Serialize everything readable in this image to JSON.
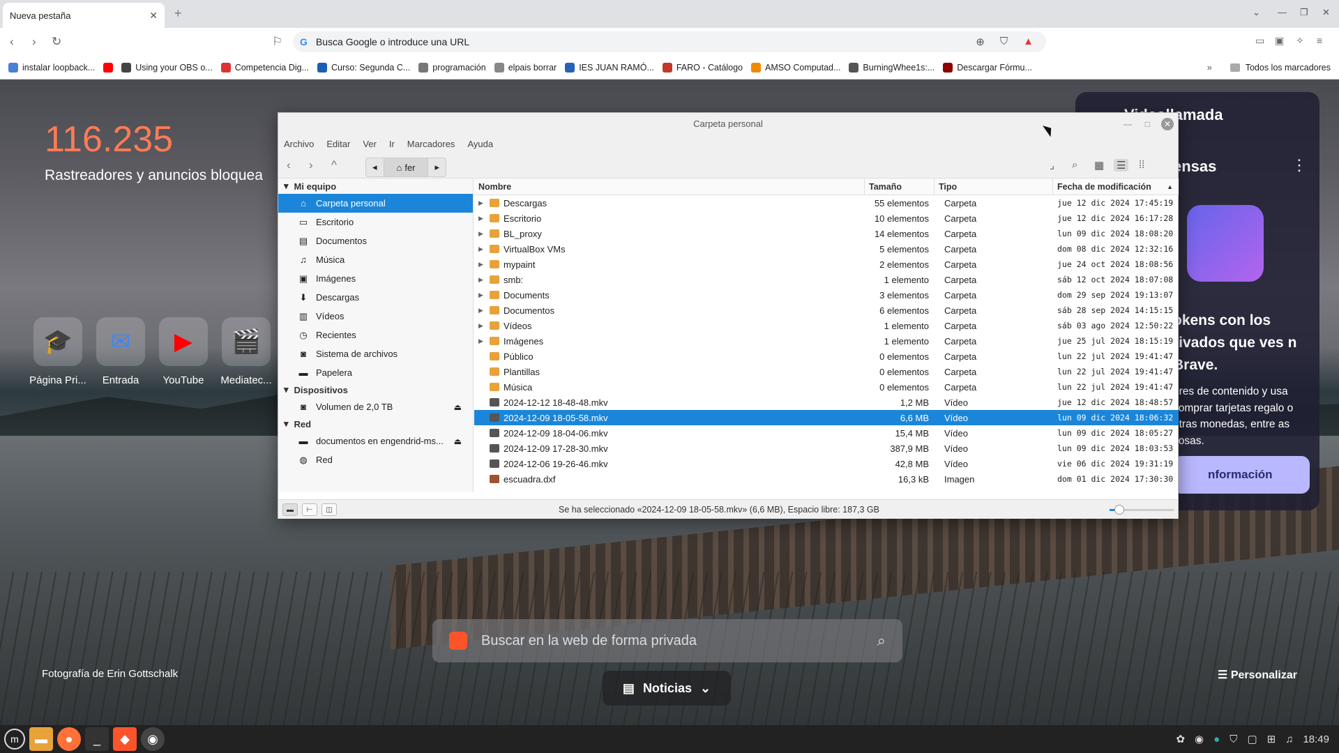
{
  "browser": {
    "tab_title": "Nueva pestaña",
    "url_placeholder": "Busca Google o introduce una URL",
    "bookmarks": [
      {
        "label": "instalar loopback...",
        "color": "#4a7fd6"
      },
      {
        "label": "",
        "color": "#ff0000"
      },
      {
        "label": "Using your OBS o...",
        "color": "#444444"
      },
      {
        "label": "Competencia Dig...",
        "color": "#d33"
      },
      {
        "label": "Curso: Segunda C...",
        "color": "#1a5fb4"
      },
      {
        "label": "programación",
        "color": "#777777"
      },
      {
        "label": "elpais borrar",
        "color": "#888888"
      },
      {
        "label": "IES JUAN RAMÓ...",
        "color": "#2563b8"
      },
      {
        "label": "FARO - Catálogo",
        "color": "#c0392b"
      },
      {
        "label": "AMSO Computad...",
        "color": "#f08a00"
      },
      {
        "label": "BurningWhee1s:...",
        "color": "#555555"
      },
      {
        "label": "Descargar Fórmu...",
        "color": "#8b0000"
      }
    ],
    "all_bookmarks": "Todos los marcadores"
  },
  "newtab": {
    "counter": "116.235",
    "counter_label": "Rastreadores y anuncios bloquea",
    "tiles": [
      {
        "label": "Página Pri...",
        "icon": "graduation-cap",
        "color": "#3a7bd5"
      },
      {
        "label": "Entrada",
        "icon": "mail",
        "color": "#4285f4"
      },
      {
        "label": "YouTube",
        "icon": "youtube",
        "color": "#ff0000"
      },
      {
        "label": "Mediatec...",
        "icon": "clapperboard",
        "color": "#2b7de9"
      }
    ],
    "photo_credit": "Fotografía de Erin Gottschalk",
    "search_placeholder": "Buscar en la web de forma privada",
    "news_label": "Noticias",
    "customize": "Personalizar"
  },
  "promo": {
    "title_top": "Videollamada",
    "title": "ensas",
    "heading": "okens con los rivados que ves n Brave.",
    "body": "ores de contenido y usa comprar tarjetas regalo o otras monedas, entre as cosas.",
    "button": "nformación"
  },
  "filemanager": {
    "title": "Carpeta personal",
    "menu": [
      "Archivo",
      "Editar",
      "Ver",
      "Ir",
      "Marcadores",
      "Ayuda"
    ],
    "path_label": "fer",
    "sidebar": {
      "section1": "Mi equipo",
      "items1": [
        {
          "label": "Carpeta personal",
          "icon": "⌂",
          "selected": true
        },
        {
          "label": "Escritorio",
          "icon": "▭"
        },
        {
          "label": "Documentos",
          "icon": "▤"
        },
        {
          "label": "Música",
          "icon": "♫"
        },
        {
          "label": "Imágenes",
          "icon": "▣"
        },
        {
          "label": "Descargas",
          "icon": "⬇"
        },
        {
          "label": "Vídeos",
          "icon": "▥"
        },
        {
          "label": "Recientes",
          "icon": "◷"
        },
        {
          "label": "Sistema de archivos",
          "icon": "◙"
        },
        {
          "label": "Papelera",
          "icon": "▬"
        }
      ],
      "section2": "Dispositivos",
      "items2": [
        {
          "label": "Volumen de 2,0 TB",
          "icon": "◙",
          "eject": true
        }
      ],
      "section3": "Red",
      "items3": [
        {
          "label": "documentos en engendrid-ms...",
          "icon": "▬",
          "eject": true
        },
        {
          "label": "Red",
          "icon": "◍"
        }
      ]
    },
    "columns": {
      "name": "Nombre",
      "size": "Tamaño",
      "type": "Tipo",
      "date": "Fecha de modificación"
    },
    "rows": [
      {
        "name": "Descargas",
        "size": "55 elementos",
        "type": "Carpeta",
        "date": "jue 12 dic 2024 17:45:19",
        "expandable": true,
        "kind": "folder"
      },
      {
        "name": "Escritorio",
        "size": "10 elementos",
        "type": "Carpeta",
        "date": "jue 12 dic 2024 16:17:28",
        "expandable": true,
        "kind": "folder"
      },
      {
        "name": "BL_proxy",
        "size": "14 elementos",
        "type": "Carpeta",
        "date": "lun 09 dic 2024 18:08:20",
        "expandable": true,
        "kind": "folder"
      },
      {
        "name": "VirtualBox VMs",
        "size": "5 elementos",
        "type": "Carpeta",
        "date": "dom 08 dic 2024 12:32:16",
        "expandable": true,
        "kind": "folder"
      },
      {
        "name": "mypaint",
        "size": "2 elementos",
        "type": "Carpeta",
        "date": "jue 24 oct 2024 18:08:56",
        "expandable": true,
        "kind": "folder"
      },
      {
        "name": "smb:",
        "size": "1 elemento",
        "type": "Carpeta",
        "date": "sáb 12 oct 2024 18:07:08",
        "expandable": true,
        "kind": "folder"
      },
      {
        "name": "Documents",
        "size": "3 elementos",
        "type": "Carpeta",
        "date": "dom 29 sep 2024 19:13:07",
        "expandable": true,
        "kind": "folder"
      },
      {
        "name": "Documentos",
        "size": "6 elementos",
        "type": "Carpeta",
        "date": "sáb 28 sep 2024 14:15:15",
        "expandable": true,
        "kind": "folder"
      },
      {
        "name": "Vídeos",
        "size": "1 elemento",
        "type": "Carpeta",
        "date": "sáb 03 ago 2024 12:50:22",
        "expandable": true,
        "kind": "folder"
      },
      {
        "name": "Imágenes",
        "size": "1 elemento",
        "type": "Carpeta",
        "date": "jue 25 jul 2024 18:15:19",
        "expandable": true,
        "kind": "folder"
      },
      {
        "name": "Público",
        "size": "0 elementos",
        "type": "Carpeta",
        "date": "lun 22 jul 2024 19:41:47",
        "expandable": false,
        "kind": "folder"
      },
      {
        "name": "Plantillas",
        "size": "0 elementos",
        "type": "Carpeta",
        "date": "lun 22 jul 2024 19:41:47",
        "expandable": false,
        "kind": "folder"
      },
      {
        "name": "Música",
        "size": "0 elementos",
        "type": "Carpeta",
        "date": "lun 22 jul 2024 19:41:47",
        "expandable": false,
        "kind": "folder"
      },
      {
        "name": "2024-12-12 18-48-48.mkv",
        "size": "1,2 MB",
        "type": "Vídeo",
        "date": "jue 12 dic 2024 18:48:57",
        "expandable": false,
        "kind": "video"
      },
      {
        "name": "2024-12-09 18-05-58.mkv",
        "size": "6,6 MB",
        "type": "Vídeo",
        "date": "lun 09 dic 2024 18:06:32",
        "expandable": false,
        "kind": "video",
        "selected": true
      },
      {
        "name": "2024-12-09 18-04-06.mkv",
        "size": "15,4 MB",
        "type": "Vídeo",
        "date": "lun 09 dic 2024 18:05:27",
        "expandable": false,
        "kind": "video"
      },
      {
        "name": "2024-12-09 17-28-30.mkv",
        "size": "387,9 MB",
        "type": "Vídeo",
        "date": "lun 09 dic 2024 18:03:53",
        "expandable": false,
        "kind": "video"
      },
      {
        "name": "2024-12-06 19-26-46.mkv",
        "size": "42,8 MB",
        "type": "Vídeo",
        "date": "vie 06 dic 2024 19:31:19",
        "expandable": false,
        "kind": "video"
      },
      {
        "name": "escuadra.dxf",
        "size": "16,3 kB",
        "type": "Imagen",
        "date": "dom 01 dic 2024 17:30:30",
        "expandable": false,
        "kind": "image"
      }
    ],
    "status": "Se ha seleccionado «2024-12-09 18-05-58.mkv» (6,6 MB), Espacio libre: 187,3 GB",
    "zoom_level": 0.15
  },
  "taskbar": {
    "clock": "18:49"
  },
  "colors": {
    "selection": "#1b86d9",
    "accent": "#ff7b54",
    "folder": "#e8a23a"
  }
}
